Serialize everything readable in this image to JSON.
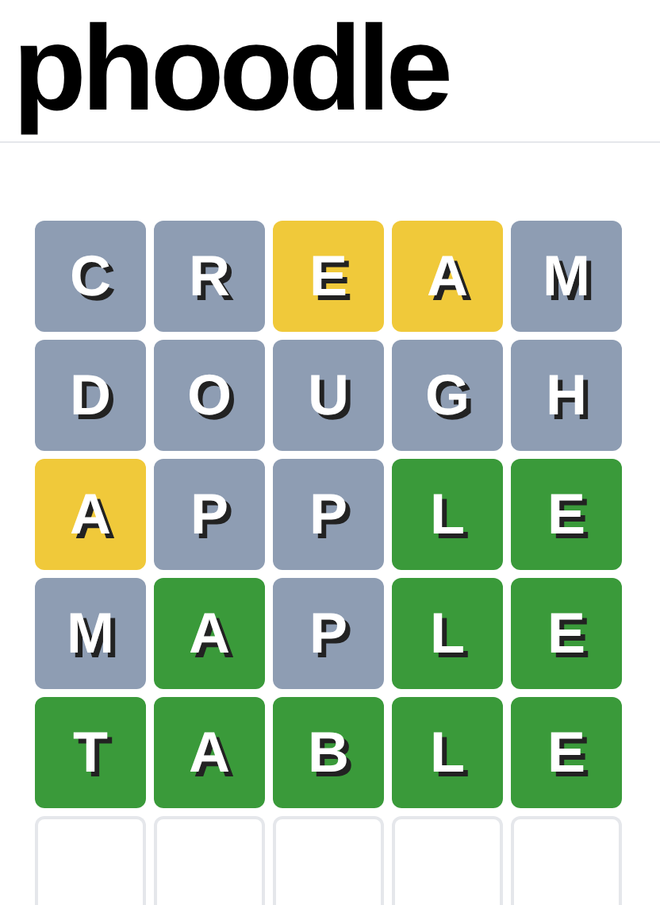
{
  "logo": "phoodle",
  "board": [
    [
      {
        "letter": "C",
        "color": "#8e9db3"
      },
      {
        "letter": "R",
        "color": "#8e9db3"
      },
      {
        "letter": "E",
        "color": "#f0c93a"
      },
      {
        "letter": "A",
        "color": "#f0c93a"
      },
      {
        "letter": "M",
        "color": "#8e9db3"
      }
    ],
    [
      {
        "letter": "D",
        "color": "#8e9db3"
      },
      {
        "letter": "O",
        "color": "#8e9db3"
      },
      {
        "letter": "U",
        "color": "#8e9db3"
      },
      {
        "letter": "G",
        "color": "#8e9db3"
      },
      {
        "letter": "H",
        "color": "#8e9db3"
      }
    ],
    [
      {
        "letter": "A",
        "color": "#f0c93a"
      },
      {
        "letter": "P",
        "color": "#8e9db3"
      },
      {
        "letter": "P",
        "color": "#8e9db3"
      },
      {
        "letter": "L",
        "color": "#3a9a3a"
      },
      {
        "letter": "E",
        "color": "#3a9a3a"
      }
    ],
    [
      {
        "letter": "M",
        "color": "#8e9db3"
      },
      {
        "letter": "A",
        "color": "#3a9a3a"
      },
      {
        "letter": "P",
        "color": "#8e9db3"
      },
      {
        "letter": "L",
        "color": "#3a9a3a"
      },
      {
        "letter": "E",
        "color": "#3a9a3a"
      }
    ],
    [
      {
        "letter": "T",
        "color": "#3a9a3a"
      },
      {
        "letter": "A",
        "color": "#3a9a3a"
      },
      {
        "letter": "B",
        "color": "#3a9a3a"
      },
      {
        "letter": "L",
        "color": "#3a9a3a"
      },
      {
        "letter": "E",
        "color": "#3a9a3a"
      }
    ],
    [
      {
        "color": "#ffffff"
      },
      {
        "color": "#ffffff"
      },
      {
        "color": "#ffffff"
      },
      {
        "color": "#ffffff"
      },
      {
        "color": "#ffffff"
      }
    ]
  ]
}
